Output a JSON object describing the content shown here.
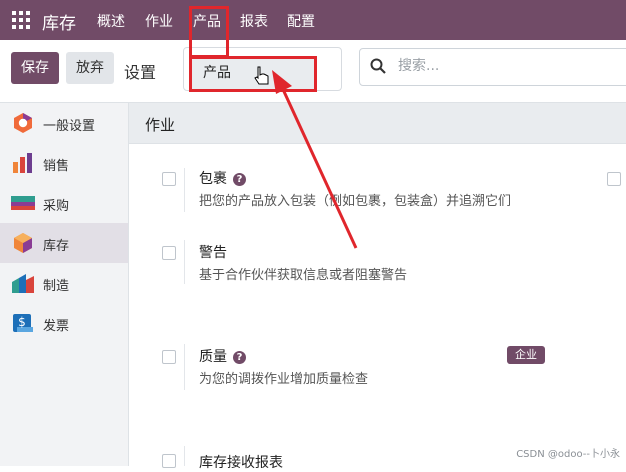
{
  "navbar": {
    "brand": "库存",
    "menu": [
      {
        "label": "概述"
      },
      {
        "label": "作业"
      },
      {
        "label": "产品"
      },
      {
        "label": "报表"
      },
      {
        "label": "配置"
      }
    ]
  },
  "control_panel": {
    "save_label": "保存",
    "discard_label": "放弃",
    "title": "设置",
    "dropdown_item": "产品",
    "search_placeholder": "搜索..."
  },
  "sidebar": {
    "items": [
      {
        "label": "一般设置",
        "icon": "general-settings-icon"
      },
      {
        "label": "销售",
        "icon": "sales-icon"
      },
      {
        "label": "采购",
        "icon": "purchase-icon"
      },
      {
        "label": "库存",
        "icon": "inventory-icon",
        "active": true
      },
      {
        "label": "制造",
        "icon": "manufacturing-icon"
      },
      {
        "label": "发票",
        "icon": "invoicing-icon"
      }
    ]
  },
  "section": {
    "title": "作业",
    "settings": [
      {
        "title": "包裹",
        "desc": "把您的产品放入包装（例如包裹，包装盒）并追溯它们",
        "help": "?"
      },
      {
        "title": "警告",
        "desc": "基于合作伙伴获取信息或者阻塞警告"
      },
      {
        "title": "质量",
        "desc": "为您的调拨作业增加质量检查",
        "help": "?",
        "badge": "企业"
      },
      {
        "title": "库存接收报表"
      }
    ]
  },
  "watermark": "CSDN @odoo--卜小永",
  "colors": {
    "brand": "#714b67",
    "annotation": "#e0262c"
  }
}
